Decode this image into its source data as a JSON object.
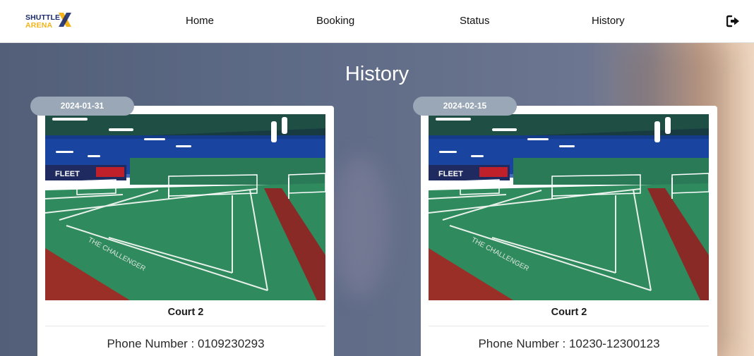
{
  "brand": {
    "logo_line1": "SHUTTLE",
    "logo_line2": "ARENA",
    "logo_mark_letter": "X"
  },
  "nav": {
    "items": [
      {
        "label": "Home"
      },
      {
        "label": "Booking"
      },
      {
        "label": "Status"
      },
      {
        "label": "History"
      }
    ],
    "logout_icon": "logout-icon"
  },
  "page": {
    "title": "History"
  },
  "history": [
    {
      "date": "2024-01-31",
      "court": "Court 2",
      "phone": "Phone Number : 0109230293",
      "image": "badminton-court-photo"
    },
    {
      "date": "2024-02-15",
      "court": "Court 2",
      "phone": "Phone Number : 10230-12300123",
      "image": "badminton-court-photo"
    }
  ],
  "colors": {
    "brand_navy": "#1b2a6b",
    "brand_yellow": "#f2b418",
    "date_pill": "#9aa7b6",
    "court_floor": "#2f8a5e"
  }
}
